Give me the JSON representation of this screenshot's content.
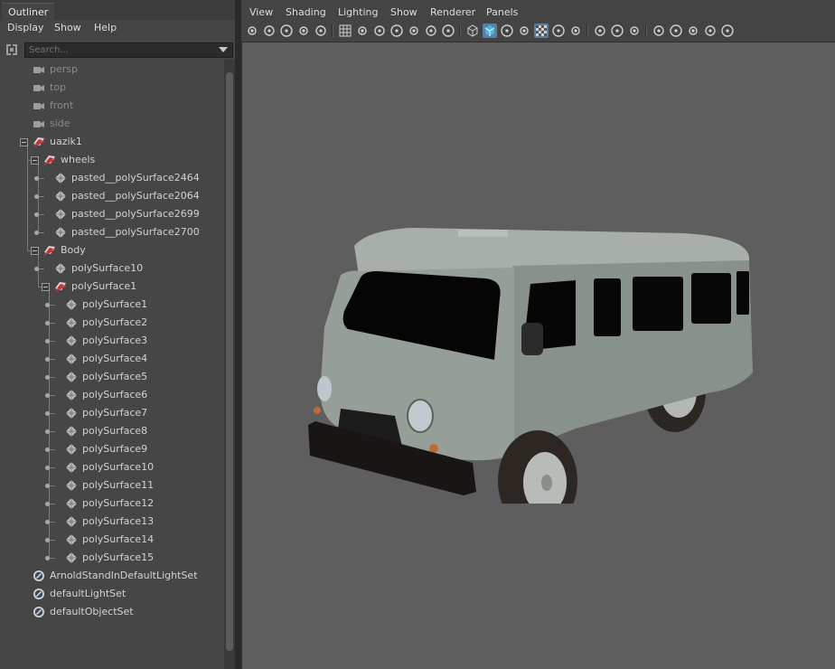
{
  "outliner": {
    "tab_title": "Outliner",
    "menu": [
      "Display",
      "Show",
      "Help"
    ],
    "search_placeholder": "Search...",
    "tree": [
      {
        "label": "persp",
        "icon": "camera-icon",
        "depth": 0,
        "dim": true
      },
      {
        "label": "top",
        "icon": "camera-icon",
        "depth": 0,
        "dim": true
      },
      {
        "label": "front",
        "icon": "camera-icon",
        "depth": 0,
        "dim": true
      },
      {
        "label": "side",
        "icon": "camera-icon",
        "depth": 0,
        "dim": true
      },
      {
        "label": "uazik1",
        "icon": "group-transform-icon",
        "depth": 0,
        "toggle": true
      },
      {
        "label": "wheels",
        "icon": "group-transform-icon",
        "depth": 1,
        "toggle": true
      },
      {
        "label": "pasted__polySurface2464",
        "icon": "mesh-icon",
        "depth": 2
      },
      {
        "label": "pasted__polySurface2064",
        "icon": "mesh-icon",
        "depth": 2
      },
      {
        "label": "pasted__polySurface2699",
        "icon": "mesh-icon",
        "depth": 2
      },
      {
        "label": "pasted__polySurface2700",
        "icon": "mesh-icon",
        "depth": 2
      },
      {
        "label": "Body",
        "icon": "group-transform-icon",
        "depth": 1,
        "toggle": true
      },
      {
        "label": "polySurface10",
        "icon": "mesh-icon",
        "depth": 2
      },
      {
        "label": "polySurface1",
        "icon": "group-transform-icon",
        "depth": 2,
        "toggle": true
      },
      {
        "label": "polySurface1",
        "icon": "mesh-icon",
        "depth": 3
      },
      {
        "label": "polySurface2",
        "icon": "mesh-icon",
        "depth": 3
      },
      {
        "label": "polySurface3",
        "icon": "mesh-icon",
        "depth": 3
      },
      {
        "label": "polySurface4",
        "icon": "mesh-icon",
        "depth": 3
      },
      {
        "label": "polySurface5",
        "icon": "mesh-icon",
        "depth": 3
      },
      {
        "label": "polySurface6",
        "icon": "mesh-icon",
        "depth": 3
      },
      {
        "label": "polySurface7",
        "icon": "mesh-icon",
        "depth": 3
      },
      {
        "label": "polySurface8",
        "icon": "mesh-icon",
        "depth": 3
      },
      {
        "label": "polySurface9",
        "icon": "mesh-icon",
        "depth": 3
      },
      {
        "label": "polySurface10",
        "icon": "mesh-icon",
        "depth": 3
      },
      {
        "label": "polySurface11",
        "icon": "mesh-icon",
        "depth": 3
      },
      {
        "label": "polySurface12",
        "icon": "mesh-icon",
        "depth": 3
      },
      {
        "label": "polySurface13",
        "icon": "mesh-icon",
        "depth": 3
      },
      {
        "label": "polySurface14",
        "icon": "mesh-icon",
        "depth": 3
      },
      {
        "label": "polySurface15",
        "icon": "mesh-icon",
        "depth": 3
      },
      {
        "label": "ArnoldStandInDefaultLightSet",
        "icon": "object-set-icon",
        "depth": 0
      },
      {
        "label": "defaultLightSet",
        "icon": "object-set-icon",
        "depth": 0
      },
      {
        "label": "defaultObjectSet",
        "icon": "object-set-icon",
        "depth": 0
      }
    ]
  },
  "viewport": {
    "menu": [
      "View",
      "Shading",
      "Lighting",
      "Show",
      "Renderer",
      "Panels"
    ],
    "toolbar_icons": [
      "select-camera-icon",
      "camera-attributes-icon",
      "bookmark-icon",
      "camera-tools-icon",
      "image-plane-icon",
      "grid-icon",
      "film-gate-icon",
      "resolution-gate-icon",
      "gate-mask-icon",
      "field-chart-icon",
      "safe-action-icon",
      "safe-title-icon",
      "wireframe-icon",
      "smooth-shade-icon",
      "default-material-icon",
      "wireframe-on-shaded-icon",
      "textured-icon",
      "use-lights-icon",
      "shadows-icon",
      "screen-space-ao-icon",
      "motion-blur-icon",
      "anti-aliasing-icon",
      "isolate-select-icon",
      "xray-icon",
      "xray-joints-icon",
      "backface-icon",
      "two-panel-icon"
    ],
    "active_toolbar_icons": [
      "smooth-shade-icon",
      "textured-icon"
    ]
  },
  "colors": {
    "panel_bg": "#444444",
    "viewport_bg": "#5e5e5e",
    "highlight": "#5a7fa0",
    "van_body": "#8f9991"
  }
}
